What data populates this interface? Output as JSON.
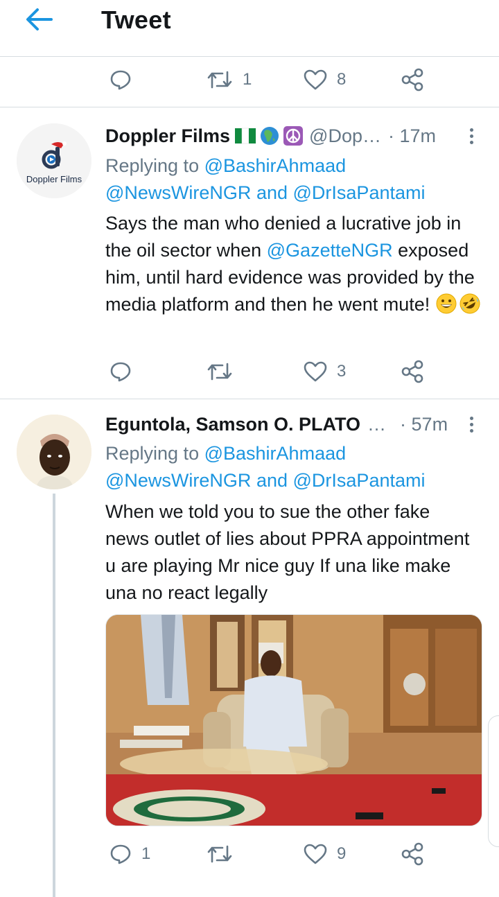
{
  "header": {
    "title": "Tweet"
  },
  "main_tweet_actions": {
    "retweets": "1",
    "likes": "8"
  },
  "replies": [
    {
      "display_name": "Doppler Films",
      "name_emoji": [
        "nigeria-flag",
        "globe-africa",
        "peace-symbol"
      ],
      "handle": "@Dop…",
      "time": "· 17m",
      "avatar_logo_text": "Doppler Films",
      "replying_prefix": "Replying to",
      "replying_to_1": "@BashirAhmaad",
      "replying_to_2": "@NewsWireNGR",
      "replying_and": "and",
      "replying_to_3": "@DrIsaPantami",
      "text_part_1": "Says the man who denied a lucrative job in the oil sector when",
      "text_mention": "@GazetteNGR",
      "text_part_2": "exposed him, until hard evidence was provided by the media platform and then he went mute!",
      "text_emoji": [
        "grinning-face",
        "rolling-on-floor-laughing"
      ],
      "replies_count": "",
      "retweets_count": "",
      "likes_count": "3"
    },
    {
      "display_name": "Eguntola, Samson O. PLATO",
      "name_overflow": "…",
      "time": "· 57m",
      "replying_prefix": "Replying to",
      "replying_to_1": "@BashirAhmaad",
      "replying_to_2": "@NewsWireNGR",
      "replying_and": "and",
      "replying_to_3": "@DrIsaPantami",
      "text": "When we told you to sue the other fake news outlet of lies about PPRA appointment u are playing Mr nice guy If una like make una no react legally",
      "media": "photo of a man in white attire seated on a couch in a living room",
      "replies_count": "1",
      "retweets_count": "",
      "likes_count": "9"
    }
  ],
  "colors": {
    "accent": "#1b95e0",
    "muted": "#657786",
    "text": "#14171a",
    "border": "#d6dce0"
  }
}
